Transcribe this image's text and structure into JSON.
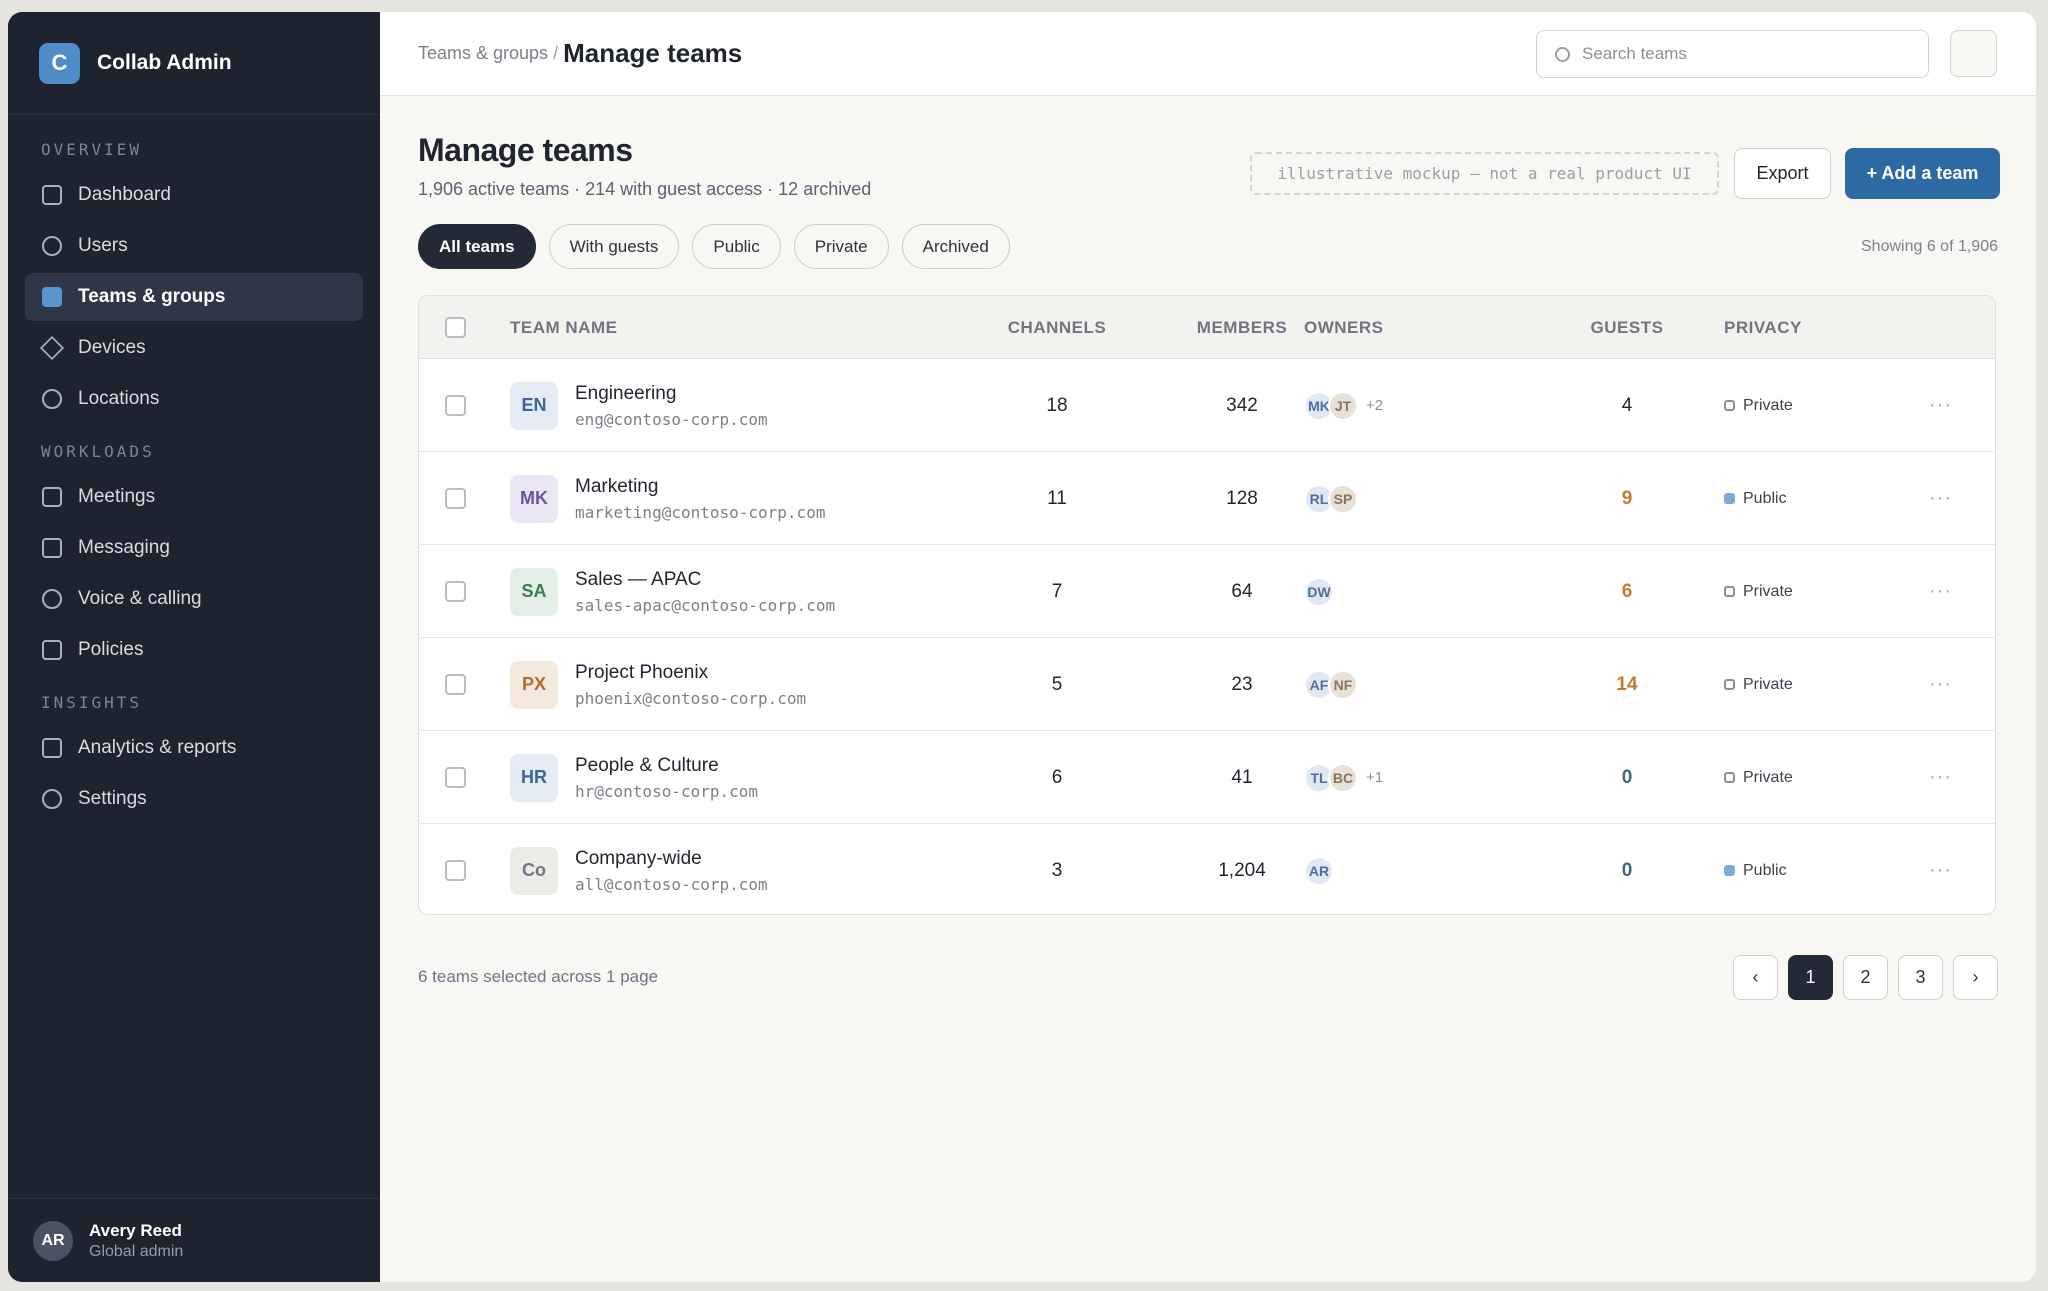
{
  "brand": {
    "logo_letter": "C",
    "name": "Collab Admin"
  },
  "sidebar": {
    "sections": [
      {
        "label": "OVERVIEW",
        "items": [
          {
            "label": "Dashboard",
            "icon": "square"
          },
          {
            "label": "Users",
            "icon": "circle"
          },
          {
            "label": "Teams & groups",
            "icon": "filled-square",
            "active": true
          },
          {
            "label": "Devices",
            "icon": "diamond"
          },
          {
            "label": "Locations",
            "icon": "circle"
          }
        ]
      },
      {
        "label": "WORKLOADS",
        "items": [
          {
            "label": "Meetings",
            "icon": "square"
          },
          {
            "label": "Messaging",
            "icon": "square"
          },
          {
            "label": "Voice & calling",
            "icon": "circle"
          },
          {
            "label": "Policies",
            "icon": "square"
          }
        ]
      },
      {
        "label": "INSIGHTS",
        "items": [
          {
            "label": "Analytics & reports",
            "icon": "square"
          },
          {
            "label": "Settings",
            "icon": "circle"
          }
        ]
      }
    ],
    "user": {
      "initials": "AR",
      "name": "Avery Reed",
      "role": "Global admin"
    }
  },
  "topbar": {
    "breadcrumb_parent": "Teams & groups",
    "breadcrumb_sep": "/",
    "breadcrumb_current": "Manage teams",
    "search_placeholder": "Search teams"
  },
  "header": {
    "title": "Manage teams",
    "subtitle": "1,906 active teams · 214 with guest access · 12 archived",
    "mock_note": "illustrative mockup — not a real product UI",
    "export_label": "Export",
    "add_label": "+ Add a team"
  },
  "filters": [
    "All teams",
    "With guests",
    "Public",
    "Private",
    "Archived"
  ],
  "active_filter": "All teams",
  "showing": "Showing 6 of 1,906",
  "table": {
    "columns": [
      "TEAM NAME",
      "CHANNELS",
      "MEMBERS",
      "OWNERS",
      "GUESTS",
      "PRIVACY"
    ],
    "rows": [
      {
        "abbr": "EN",
        "name": "Engineering",
        "email": "eng@contoso-corp.com",
        "channels": "18",
        "members": "342",
        "owners": [
          "MK",
          "JT"
        ],
        "owners_more": "+2",
        "guests": "4",
        "guests_color": "#1f2430",
        "privacy": "Private",
        "icon_bg": "#e4ebf4",
        "icon_fg": "#3f6596"
      },
      {
        "abbr": "MK",
        "name": "Marketing",
        "email": "marketing@contoso-corp.com",
        "channels": "11",
        "members": "128",
        "owners": [
          "RL",
          "SP"
        ],
        "owners_more": "",
        "guests": "9",
        "guests_color": "#c27a2c",
        "privacy": "Public",
        "icon_bg": "#ebe6f3",
        "icon_fg": "#6a55a0"
      },
      {
        "abbr": "SA",
        "name": "Sales — APAC",
        "email": "sales-apac@contoso-corp.com",
        "channels": "7",
        "members": "64",
        "owners": [
          "DW"
        ],
        "owners_more": "",
        "guests": "6",
        "guests_color": "#c27a2c",
        "privacy": "Private",
        "icon_bg": "#e3efe6",
        "icon_fg": "#3d7a4f"
      },
      {
        "abbr": "PX",
        "name": "Project Phoenix",
        "email": "phoenix@contoso-corp.com",
        "channels": "5",
        "members": "23",
        "owners": [
          "AF",
          "NF"
        ],
        "owners_more": "",
        "guests": "14",
        "guests_color": "#c27a2c",
        "privacy": "Private",
        "icon_bg": "#f5e8dd",
        "icon_fg": "#b06a35"
      },
      {
        "abbr": "HR",
        "name": "People & Culture",
        "email": "hr@contoso-corp.com",
        "channels": "6",
        "members": "41",
        "owners": [
          "TL",
          "BC"
        ],
        "owners_more": "+1",
        "guests": "0",
        "guests_color": "#3f6a7a",
        "privacy": "Private",
        "icon_bg": "#e4ebf4",
        "icon_fg": "#3f6596"
      },
      {
        "abbr": "Co",
        "name": "Company-wide",
        "email": "all@contoso-corp.com",
        "channels": "3",
        "members": "1,204",
        "owners": [
          "AR"
        ],
        "owners_more": "",
        "guests": "0",
        "guests_color": "#3f6a7a",
        "privacy": "Public",
        "icon_bg": "#ecebe8",
        "icon_fg": "#6f7581"
      }
    ],
    "row_menu": "···"
  },
  "footer": {
    "note": "6 teams selected across 1 page"
  },
  "pagination": {
    "prev": "‹",
    "pages": [
      "1",
      "2",
      "3"
    ],
    "current": "1",
    "next": "›"
  }
}
